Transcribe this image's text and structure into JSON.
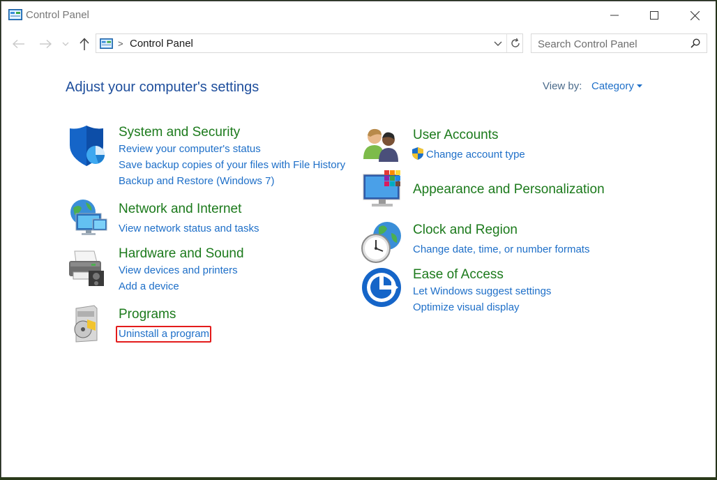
{
  "window": {
    "title": "Control Panel"
  },
  "address": {
    "separator": ">",
    "path": "Control Panel"
  },
  "search": {
    "placeholder": "Search Control Panel"
  },
  "main": {
    "heading": "Adjust your computer's settings",
    "view_by_label": "View by:",
    "view_by_value": "Category"
  },
  "categories": [
    {
      "title": "System and Security",
      "icon": "shield-icon",
      "links": [
        "Review your computer's status",
        "Save backup copies of your files with File History",
        "Backup and Restore (Windows 7)"
      ]
    },
    {
      "title": "Network and Internet",
      "icon": "network-icon",
      "links": [
        "View network status and tasks"
      ]
    },
    {
      "title": "Hardware and Sound",
      "icon": "printer-icon",
      "links": [
        "View devices and printers",
        "Add a device"
      ]
    },
    {
      "title": "Programs",
      "icon": "programs-icon",
      "links": [
        "Uninstall a program"
      ]
    },
    {
      "title": "User Accounts",
      "icon": "users-icon",
      "links": [
        "Change account type"
      ]
    },
    {
      "title": "Appearance and Personalization",
      "icon": "appearance-icon",
      "links": []
    },
    {
      "title": "Clock and Region",
      "icon": "clock-globe-icon",
      "links": [
        "Change date, time, or number formats"
      ]
    },
    {
      "title": "Ease of Access",
      "icon": "ease-of-access-icon",
      "links": [
        "Let Windows suggest settings",
        "Optimize visual display"
      ]
    }
  ],
  "colors": {
    "link": "#1e6fc8",
    "category_title": "#1c7a1c",
    "heading": "#1e4e9c",
    "highlight": "#e31b1b"
  }
}
